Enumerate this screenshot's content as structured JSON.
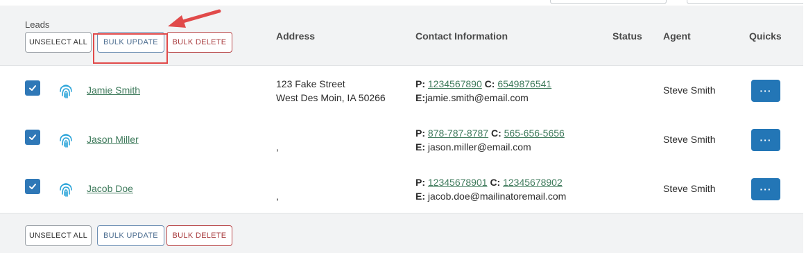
{
  "header": {
    "leads_label": "Leads",
    "columns": {
      "address": "Address",
      "contact": "Contact Information",
      "status": "Status",
      "agent": "Agent",
      "quicks": "Quicks"
    }
  },
  "toolbar": {
    "unselect_all": "UNSELECT ALL",
    "bulk_update": "BULK UPDATE",
    "bulk_delete": "BULK DELETE"
  },
  "rows": [
    {
      "name": "Jamie Smith",
      "address_line1": "123 Fake Street",
      "address_line2": "West Des Moin, IA 50266",
      "phone_label": "P:",
      "phone": "1234567890",
      "cell_label": "C:",
      "cell": "6549876541",
      "email_label": "E:",
      "email": "jamie.smith@email.com",
      "agent": "Steve Smith",
      "quick_label": "···"
    },
    {
      "name": "Jason Miller",
      "address_line1": "",
      "address_line2": ",",
      "phone_label": "P:",
      "phone": "878-787-8787",
      "cell_label": "C:",
      "cell": "565-656-5656",
      "email_label": "E:",
      "email": "jason.miller@email.com",
      "agent": "Steve Smith",
      "quick_label": "···"
    },
    {
      "name": "Jacob Doe",
      "address_line1": "",
      "address_line2": ",",
      "phone_label": "P:",
      "phone": "12345678901",
      "cell_label": "C:",
      "cell": "12345678902",
      "email_label": "E:",
      "email": "jacob.doe@mailinatoremail.com",
      "agent": "Steve Smith",
      "quick_label": "···"
    }
  ],
  "colors": {
    "checkbox": "#2f78b7",
    "quick_button": "#2376b6",
    "highlight": "#e14a4a",
    "link": "#3e7a5b",
    "fingerprint": "#29a3d8"
  }
}
